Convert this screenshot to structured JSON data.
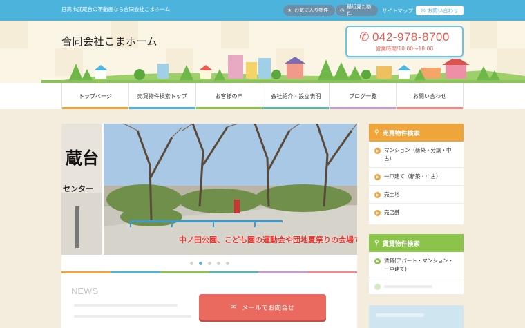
{
  "topbar": {
    "tagline": "日高市武蔵台の不動産なら合同会社こまホーム",
    "favorites": "お気に入り物件",
    "recent": "最近見た物件",
    "sitemap": "サイトマップ",
    "contact": "お問い合わせ"
  },
  "header": {
    "company": "合同会社こまホーム",
    "phone": "042-978-8700",
    "hours": "営業時間/10:00～18:00"
  },
  "nav": {
    "items": [
      {
        "label": "トップページ",
        "color": "#f0a53a"
      },
      {
        "label": "売買物件検索トップ",
        "color": "#4cb3dd"
      },
      {
        "label": "お客様の声",
        "color": "#8cc34b"
      },
      {
        "label": "会社紹介・設立表明",
        "color": "#5ab4a9"
      },
      {
        "label": "ブログ一覧",
        "color": "#c79bd0"
      },
      {
        "label": "お問い合わせ",
        "color": "#ef8a8a"
      }
    ]
  },
  "slider": {
    "sign_text": "蔵台",
    "sign_sub": "センター",
    "caption": "中ノ田公園、こども園の運動会や団地夏祭りの会場で",
    "dots": 5,
    "active_dot": 2
  },
  "news": {
    "title": "NEWS"
  },
  "mail_button": "メールでお問合せ",
  "sidebar": {
    "sale": {
      "title": "売買物件検索",
      "color": "#f0a53a",
      "items": [
        "マンション（新築・分譲・中古）",
        "一戸建て（新築・中古）",
        "売土地",
        "売店舗"
      ]
    },
    "rent": {
      "title": "賃貸物件検索",
      "color": "#8cc34b",
      "items": [
        "賃貸(アパート・マンション・一戸建て)"
      ]
    }
  },
  "colors": {
    "topbar": "#4cb3dd",
    "phone": "#e85a4f",
    "mail_button": "#ea6a5f"
  }
}
